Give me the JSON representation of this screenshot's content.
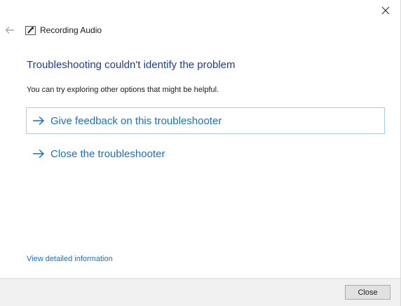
{
  "window": {
    "title": "Recording Audio",
    "icons": {
      "back": "back-arrow-icon",
      "close": "close-icon",
      "app": "recording-audio-icon",
      "option": "right-arrow-icon"
    }
  },
  "main": {
    "heading": "Troubleshooting couldn't identify the problem",
    "subtext": "You can try exploring other options that might be helpful.",
    "options": [
      {
        "label": "Give feedback on this troubleshooter",
        "selected": true
      },
      {
        "label": "Close the troubleshooter",
        "selected": false
      }
    ],
    "details_link": "View detailed information"
  },
  "footer": {
    "close_label": "Close"
  },
  "colors": {
    "heading": "#1f3d8f",
    "link": "#1a6fc4",
    "footer_bg": "#f0f0f0"
  }
}
